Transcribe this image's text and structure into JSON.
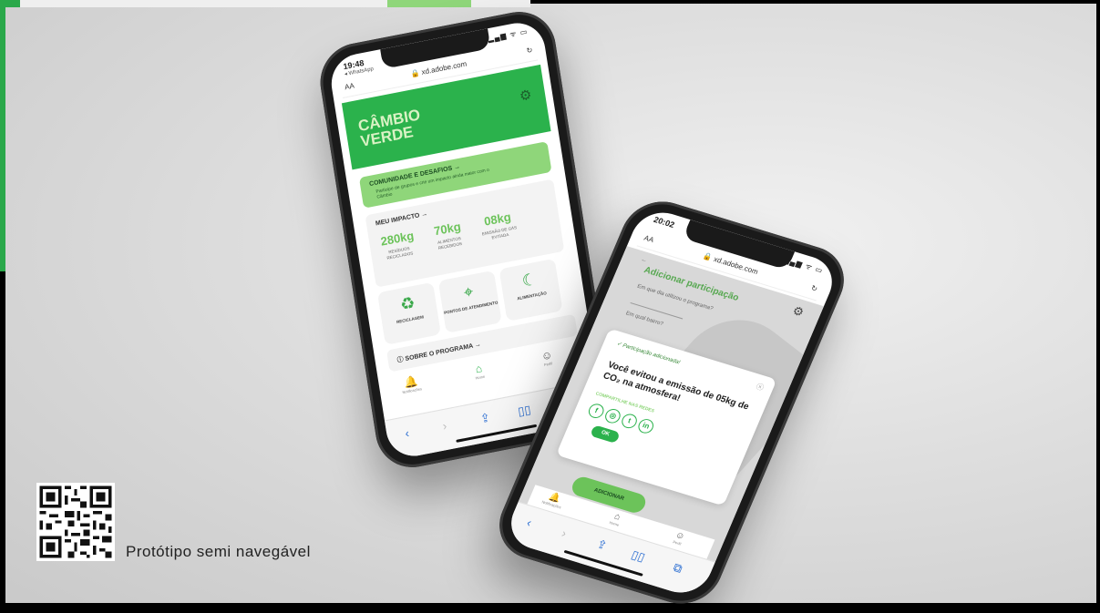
{
  "phone1": {
    "status_time": "19:48",
    "status_back": "◂ WhatsApp",
    "status_icons": "▂▄▆ ᯤ ▭",
    "url_aa": "AA",
    "url": "🔒 xd.adobe.com",
    "reload": "↻",
    "app_title": "CÂMBIO VERDE",
    "gear_icon": "⚙",
    "community": {
      "title": "COMUNIDADE E DESAFIOS →",
      "description": "Participe de grupos e crie um impacto ainda maior com o Câmbio"
    },
    "impact": {
      "title": "MEU IMPACTO →",
      "stats": [
        {
          "value": "280kg",
          "label": "RESÍDUOS RECICLADOS"
        },
        {
          "value": "70kg",
          "label": "ALIMENTOS RECEBIDOS"
        },
        {
          "value": "08kg",
          "label": "EMISSÃO DE GÁS EVITADA"
        }
      ]
    },
    "tiles": [
      {
        "icon": "♻",
        "label": "RECICLAGEM"
      },
      {
        "icon": "⌖",
        "label": "PONTOS DE ATENDIMENTO"
      },
      {
        "icon": "☾",
        "label": "ALIMENTAÇÃO"
      }
    ],
    "about": "ⓘ SOBRE O PROGRAMA →",
    "tabs": [
      {
        "icon": "🔔",
        "label": "Notificações"
      },
      {
        "icon": "⌂",
        "label": "Home"
      },
      {
        "icon": "☺",
        "label": "Perfil"
      }
    ],
    "safari": [
      "‹",
      "›",
      "⇪",
      "▯▯",
      "⧉"
    ]
  },
  "phone2": {
    "status_time": "20:02",
    "status_icons": "▂▄▆ ᯤ ▭",
    "url_aa": "AA",
    "url": "🔒 xd.adobe.com",
    "reload": "↻",
    "back_arrow": "←",
    "title": "Adicionar participação",
    "gear_icon": "⚙",
    "question1": "Em que dia utilizou o programa?",
    "question2": "Em qual bairro?",
    "modal": {
      "header": "✓ Participação adicionada!",
      "close": "ⓧ",
      "message": "Você evitou a emissão de 05kg de CO₂ na atmosfera!",
      "share_label": "COMPARTILHE NAS REDES",
      "socials": [
        "f",
        "◎",
        "t",
        "in"
      ],
      "ok": "OK"
    },
    "add_button": "ADICIONAR",
    "tabs": [
      {
        "icon": "🔔",
        "label": "Notificações"
      },
      {
        "icon": "⌂",
        "label": "Home"
      },
      {
        "icon": "☺",
        "label": "Perfil"
      }
    ],
    "safari": [
      "‹",
      "›",
      "⇪",
      "▯▯",
      "⧉"
    ]
  },
  "caption": "Protótipo semi navegável",
  "colors": {
    "brand_green": "#2bb24c",
    "light_green": "#8fd67a",
    "accent_green": "#6cc35a"
  }
}
